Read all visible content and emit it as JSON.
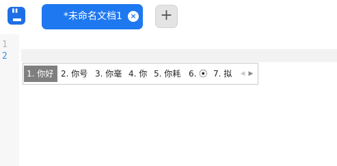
{
  "tab": {
    "title": "*未命名文档1",
    "close_symbol": "×"
  },
  "new_tab_symbol": "+",
  "logo_glyph": "\"",
  "gutter": {
    "lines": [
      "1",
      "2"
    ]
  },
  "ime": {
    "candidates": [
      "1. 你好",
      "2. 你号",
      "3. 你毫",
      "4. 你",
      "5. 你耗",
      "6. ⦿",
      "7. 拟"
    ],
    "selected_index": 0,
    "prev_symbol": "◀",
    "next_symbol": "▶"
  },
  "colors": {
    "accent": "#1e78f0",
    "logo": "#1e6fe6",
    "active_line_number": "#3c8ee6",
    "selected_candidate_bg": "#7f7f7f"
  },
  "icons": {
    "logo": "quote-doc-icon",
    "close": "close-icon",
    "add": "plus-icon",
    "prev": "chevron-left-icon",
    "next": "chevron-right-icon"
  }
}
